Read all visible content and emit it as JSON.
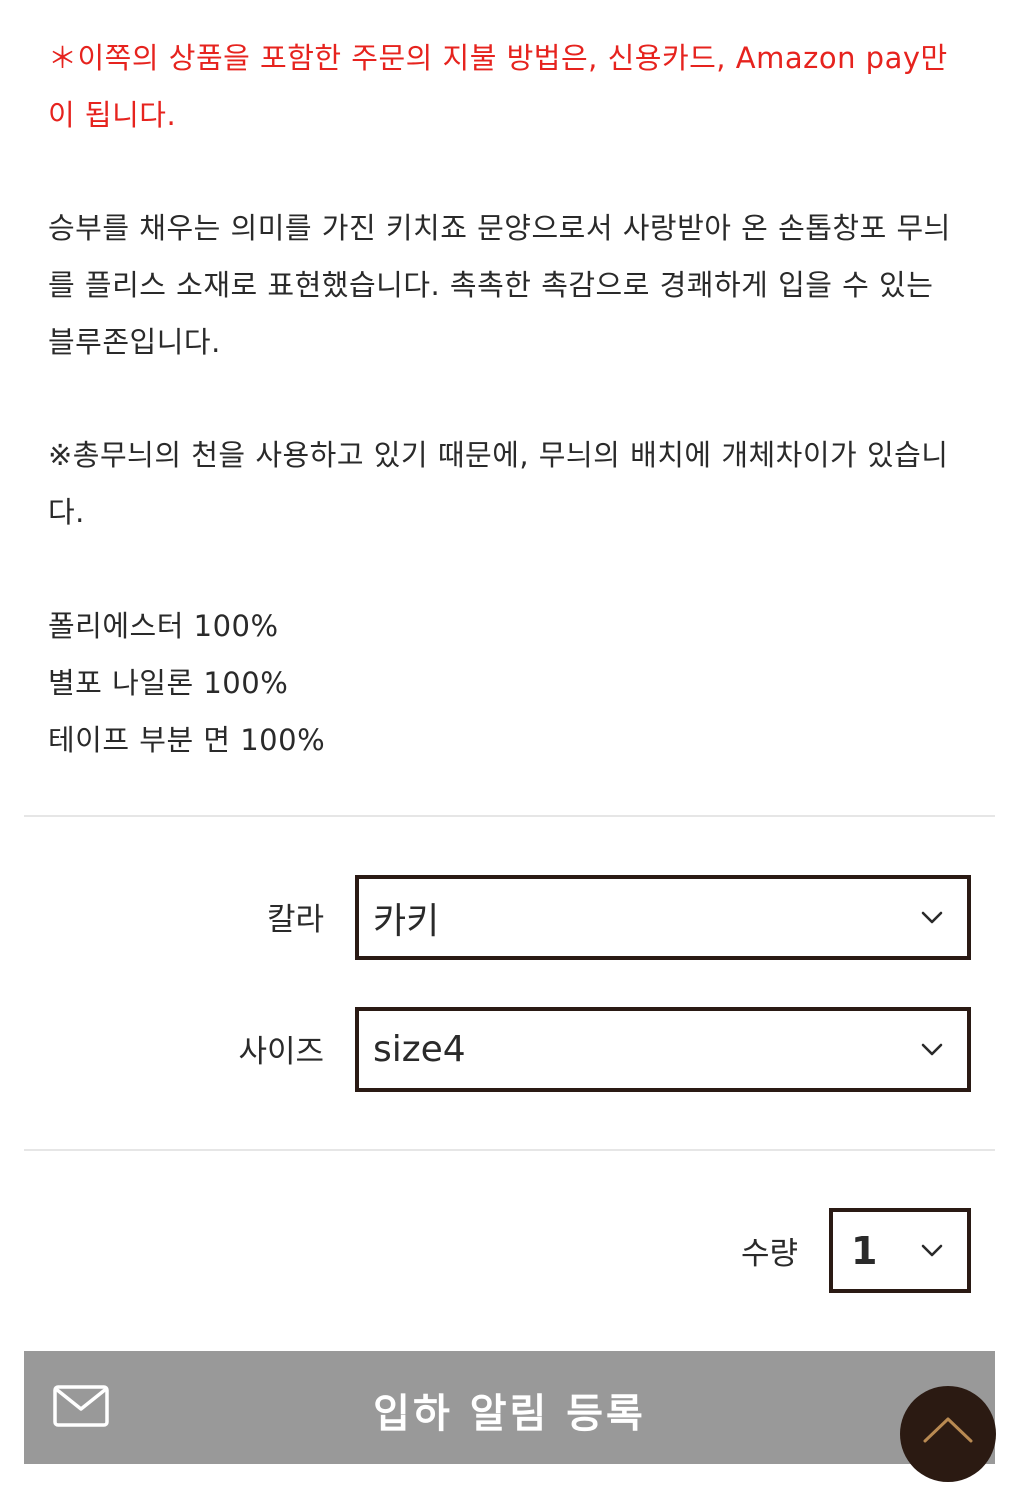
{
  "product_info": {
    "payment_notice_lines": [
      "＊이쪽의 상품을 포함한 주문의 지불 방법은, 신용카드, Amazon pay만",
      "이 됩니다."
    ],
    "description_lines": [
      "승부를 채우는 의미를 가진 키치죠 문양으로서 사랑받아 온 손톱창포 무늬",
      "를 플리스 소재로 표현했습니다. 촉촉한 촉감으로 경쾌하게 입을 수 있는",
      "블루존입니다."
    ],
    "caution_lines": [
      "※총무늬의 천을 사용하고 있기 때문에, 무늬의 배치에 개체차이가 있습니",
      "다."
    ],
    "materials": [
      "폴리에스터 100%",
      "별포 나일론 100%",
      "테이프 부분 면 100%"
    ]
  },
  "options": {
    "color": {
      "label": "칼라",
      "selected": "카키"
    },
    "size": {
      "label": "사이즈",
      "selected": "size4"
    }
  },
  "quantity": {
    "label": "수량",
    "selected": "1"
  },
  "actions": {
    "notify_label": "입하 알림 등록",
    "notify_icon": "mail-icon",
    "back_to_top_icon": "chevron-up-icon"
  },
  "colors": {
    "notice_red": "#e6231e",
    "select_border": "#2a1a14",
    "notify_bar": "#999999",
    "back_to_top_bg": "#2b1a12"
  }
}
